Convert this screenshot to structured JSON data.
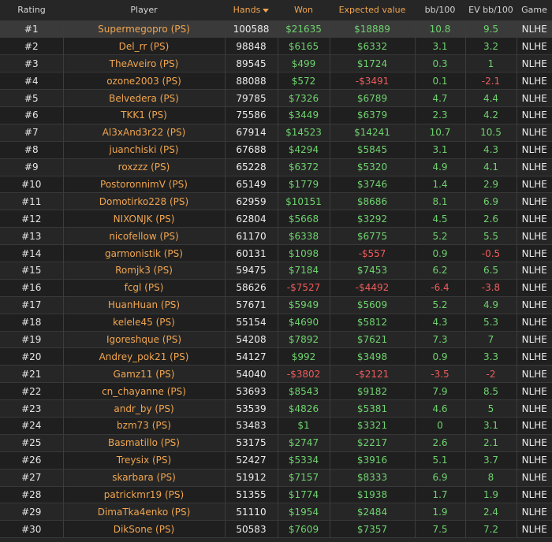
{
  "headers": {
    "rating": "Rating",
    "player": "Player",
    "hands": "Hands",
    "won": "Won",
    "expected": "Expected value",
    "bb100": "bb/100",
    "evbb100": "EV bb/100",
    "game": "Game"
  },
  "colors": {
    "accent": "#f0a550",
    "positive": "#6fd36f",
    "negative": "#ef5b5b",
    "background": "#262626"
  },
  "sort": {
    "column": "hands",
    "direction": "desc",
    "icon": "caret-down-icon"
  },
  "selected_row": 0,
  "rows": [
    {
      "rating": "#1",
      "player": "Supermegopro (PS)",
      "hands": "100588",
      "won": "$21635",
      "ev": "$18889",
      "bb": "10.8",
      "evbb": "9.5",
      "game": "NLHE"
    },
    {
      "rating": "#2",
      "player": "Del_rr (PS)",
      "hands": "98848",
      "won": "$6165",
      "ev": "$6332",
      "bb": "3.1",
      "evbb": "3.2",
      "game": "NLHE"
    },
    {
      "rating": "#3",
      "player": "TheAveiro (PS)",
      "hands": "89545",
      "won": "$499",
      "ev": "$1724",
      "bb": "0.3",
      "evbb": "1",
      "game": "NLHE"
    },
    {
      "rating": "#4",
      "player": "ozone2003 (PS)",
      "hands": "88088",
      "won": "$572",
      "ev": "-$3491",
      "bb": "0.1",
      "evbb": "-2.1",
      "game": "NLHE"
    },
    {
      "rating": "#5",
      "player": "Belvedera (PS)",
      "hands": "79785",
      "won": "$7326",
      "ev": "$6789",
      "bb": "4.7",
      "evbb": "4.4",
      "game": "NLHE"
    },
    {
      "rating": "#6",
      "player": "TKK1 (PS)",
      "hands": "75586",
      "won": "$3449",
      "ev": "$6379",
      "bb": "2.3",
      "evbb": "4.2",
      "game": "NLHE"
    },
    {
      "rating": "#7",
      "player": "Al3xAnd3r22 (PS)",
      "hands": "67914",
      "won": "$14523",
      "ev": "$14241",
      "bb": "10.7",
      "evbb": "10.5",
      "game": "NLHE"
    },
    {
      "rating": "#8",
      "player": "juanchiski (PS)",
      "hands": "67688",
      "won": "$4294",
      "ev": "$5845",
      "bb": "3.1",
      "evbb": "4.3",
      "game": "NLHE"
    },
    {
      "rating": "#9",
      "player": "roxzzz (PS)",
      "hands": "65228",
      "won": "$6372",
      "ev": "$5320",
      "bb": "4.9",
      "evbb": "4.1",
      "game": "NLHE"
    },
    {
      "rating": "#10",
      "player": "PostoronnimV (PS)",
      "hands": "65149",
      "won": "$1779",
      "ev": "$3746",
      "bb": "1.4",
      "evbb": "2.9",
      "game": "NLHE"
    },
    {
      "rating": "#11",
      "player": "Domotirko228 (PS)",
      "hands": "62959",
      "won": "$10151",
      "ev": "$8686",
      "bb": "8.1",
      "evbb": "6.9",
      "game": "NLHE"
    },
    {
      "rating": "#12",
      "player": "NIXONJK (PS)",
      "hands": "62804",
      "won": "$5668",
      "ev": "$3292",
      "bb": "4.5",
      "evbb": "2.6",
      "game": "NLHE"
    },
    {
      "rating": "#13",
      "player": "nicofellow (PS)",
      "hands": "61170",
      "won": "$6338",
      "ev": "$6775",
      "bb": "5.2",
      "evbb": "5.5",
      "game": "NLHE"
    },
    {
      "rating": "#14",
      "player": "garmonistik (PS)",
      "hands": "60131",
      "won": "$1098",
      "ev": "-$557",
      "bb": "0.9",
      "evbb": "-0.5",
      "game": "NLHE"
    },
    {
      "rating": "#15",
      "player": "Romjk3 (PS)",
      "hands": "59475",
      "won": "$7184",
      "ev": "$7453",
      "bb": "6.2",
      "evbb": "6.5",
      "game": "NLHE"
    },
    {
      "rating": "#16",
      "player": "fcgl (PS)",
      "hands": "58626",
      "won": "-$7527",
      "ev": "-$4492",
      "bb": "-6.4",
      "evbb": "-3.8",
      "game": "NLHE"
    },
    {
      "rating": "#17",
      "player": "HuanHuan (PS)",
      "hands": "57671",
      "won": "$5949",
      "ev": "$5609",
      "bb": "5.2",
      "evbb": "4.9",
      "game": "NLHE"
    },
    {
      "rating": "#18",
      "player": "kelele45 (PS)",
      "hands": "55154",
      "won": "$4690",
      "ev": "$5812",
      "bb": "4.3",
      "evbb": "5.3",
      "game": "NLHE"
    },
    {
      "rating": "#19",
      "player": "Igoreshque (PS)",
      "hands": "54208",
      "won": "$7892",
      "ev": "$7621",
      "bb": "7.3",
      "evbb": "7",
      "game": "NLHE"
    },
    {
      "rating": "#20",
      "player": "Andrey_pok21 (PS)",
      "hands": "54127",
      "won": "$992",
      "ev": "$3498",
      "bb": "0.9",
      "evbb": "3.3",
      "game": "NLHE"
    },
    {
      "rating": "#21",
      "player": "Gamz11 (PS)",
      "hands": "54040",
      "won": "-$3802",
      "ev": "-$2121",
      "bb": "-3.5",
      "evbb": "-2",
      "game": "NLHE"
    },
    {
      "rating": "#22",
      "player": "cn_chayanne (PS)",
      "hands": "53693",
      "won": "$8543",
      "ev": "$9182",
      "bb": "7.9",
      "evbb": "8.5",
      "game": "NLHE"
    },
    {
      "rating": "#23",
      "player": "andr_by (PS)",
      "hands": "53539",
      "won": "$4826",
      "ev": "$5381",
      "bb": "4.6",
      "evbb": "5",
      "game": "NLHE"
    },
    {
      "rating": "#24",
      "player": "bzm73 (PS)",
      "hands": "53483",
      "won": "$1",
      "ev": "$3321",
      "bb": "0",
      "evbb": "3.1",
      "game": "NLHE"
    },
    {
      "rating": "#25",
      "player": "Basmatillo (PS)",
      "hands": "53175",
      "won": "$2747",
      "ev": "$2217",
      "bb": "2.6",
      "evbb": "2.1",
      "game": "NLHE"
    },
    {
      "rating": "#26",
      "player": "Treysix (PS)",
      "hands": "52427",
      "won": "$5334",
      "ev": "$3916",
      "bb": "5.1",
      "evbb": "3.7",
      "game": "NLHE"
    },
    {
      "rating": "#27",
      "player": "skarbara (PS)",
      "hands": "51912",
      "won": "$7157",
      "ev": "$8333",
      "bb": "6.9",
      "evbb": "8",
      "game": "NLHE"
    },
    {
      "rating": "#28",
      "player": "patrickmr19 (PS)",
      "hands": "51355",
      "won": "$1774",
      "ev": "$1938",
      "bb": "1.7",
      "evbb": "1.9",
      "game": "NLHE"
    },
    {
      "rating": "#29",
      "player": "DimaTka4enko (PS)",
      "hands": "51110",
      "won": "$1954",
      "ev": "$2484",
      "bb": "1.9",
      "evbb": "2.4",
      "game": "NLHE"
    },
    {
      "rating": "#30",
      "player": "DikSone (PS)",
      "hands": "50583",
      "won": "$7609",
      "ev": "$7357",
      "bb": "7.5",
      "evbb": "7.2",
      "game": "NLHE"
    }
  ]
}
